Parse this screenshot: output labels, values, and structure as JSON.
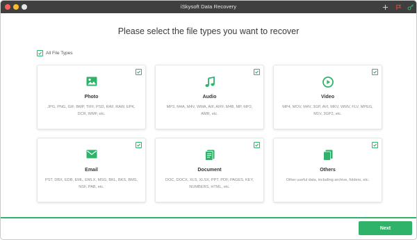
{
  "window": {
    "title": "iSkysoft Data Recovery"
  },
  "heading": "Please select the file types you want to recover",
  "all_file_types": {
    "label": "All File Types",
    "checked": true
  },
  "accent_color": "#2fb36a",
  "file_types": [
    {
      "name": "Photo",
      "icon": "image-icon",
      "checked": true,
      "desc": "JPG, PNG, GIF, BMP, TIFF, PSD, RAF, RAW, EPK, DCR, WMF, etc."
    },
    {
      "name": "Audio",
      "icon": "music-note-icon",
      "checked": true,
      "desc": "MP3, M4A, M4V, WMA, AIF, AIFF, M4B, MP, MP2, AMR, etc."
    },
    {
      "name": "Video",
      "icon": "play-icon",
      "checked": true,
      "desc": "MP4, MOV, M4V, 3GP, AVI, MKV, WMV, FLV, MPEG, M1V, 3GP2, etc."
    },
    {
      "name": "Email",
      "icon": "envelope-icon",
      "checked": true,
      "desc": "PST, DBX, EDB, EML, EMLX, MSG, BKL, BKS, BMS, NSF, PAB, etc."
    },
    {
      "name": "Document",
      "icon": "document-icon",
      "checked": true,
      "desc": "DOC, DOCX, XLS, XLSX, PPT, PDF, PAGES, KEY, NUMBERS, HTML, etc."
    },
    {
      "name": "Others",
      "icon": "files-icon",
      "checked": true,
      "desc": "Other useful data, including archive, folders, etc."
    }
  ],
  "next_label": "Next"
}
